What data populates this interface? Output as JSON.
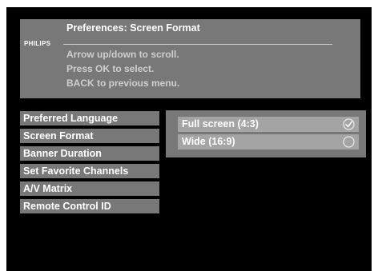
{
  "header": {
    "brand": "PHILIPS",
    "title": "Preferences: Screen Format",
    "instructions": [
      "Arrow up/down to scroll.",
      "Press OK to select.",
      "BACK to previous menu."
    ]
  },
  "menu": {
    "items": [
      {
        "label": "Preferred Language"
      },
      {
        "label": "Screen Format"
      },
      {
        "label": "Banner Duration"
      },
      {
        "label": "Set Favorite Channels"
      },
      {
        "label": "A/V Matrix"
      },
      {
        "label": "Remote Control ID"
      }
    ]
  },
  "options": {
    "items": [
      {
        "label": "Full screen (4:3)",
        "selected": true,
        "icon": "check-circle-icon"
      },
      {
        "label": "Wide (16:9)",
        "selected": false,
        "icon": "radio-circle-icon"
      }
    ]
  },
  "colors": {
    "screen_background": "#000000",
    "panel_gray": "#787878",
    "option_highlight": "#a4a4a4",
    "text": "#ffffff"
  }
}
